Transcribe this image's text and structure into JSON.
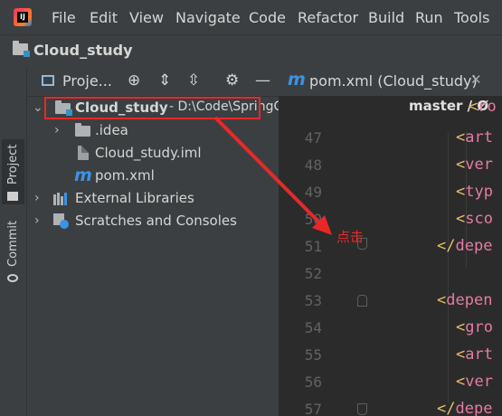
{
  "menu": {
    "items": [
      "File",
      "Edit",
      "View",
      "Navigate",
      "Code",
      "Refactor",
      "Build",
      "Run",
      "Tools"
    ],
    "logo_text": "IJ"
  },
  "navbar": {
    "project_name": "Cloud_study",
    "icon": "module-folder-icon"
  },
  "left_strip": {
    "project_tab": "Project",
    "commit_tab": "Commit"
  },
  "project_panel": {
    "title": "Proje...",
    "toolbar_icons": [
      "locate-icon",
      "expand-all-icon",
      "collapse-all-icon",
      "gear-icon",
      "minimize-icon"
    ],
    "tree": {
      "root": {
        "name": "Cloud_study",
        "path": "- D:\\Code\\SpringCloud\\Cloud_study",
        "vcs": "master / Ø"
      },
      "idea": ".idea",
      "iml": "Cloud_study.iml",
      "pom": "pom.xml",
      "external_libraries": "External Libraries",
      "scratches": "Scratches and Consoles"
    }
  },
  "editor": {
    "tab_label": "pom.xml (Cloud_study)",
    "tab_icon": "maven-icon",
    "line_numbers": [
      "47",
      "48",
      "49",
      "50",
      "51",
      "52",
      "53",
      "54",
      "55",
      "56",
      "57"
    ],
    "lines": [
      {
        "line": "47",
        "bracket": "<",
        "tag": "art"
      },
      {
        "line": "48",
        "bracket": "<",
        "tag": "ver"
      },
      {
        "line": "49",
        "bracket": "<",
        "tag": "typ"
      },
      {
        "line": "50",
        "bracket": "<",
        "tag": "sco"
      },
      {
        "line": "51",
        "bracket": "</",
        "tag": "depe"
      },
      {
        "line": "52",
        "bracket": "",
        "tag": ""
      },
      {
        "line": "53",
        "bracket": "<",
        "tag": "depen"
      },
      {
        "line": "54",
        "bracket": "<",
        "tag": "gro"
      },
      {
        "line": "55",
        "bracket": "<",
        "tag": "art"
      },
      {
        "line": "56",
        "bracket": "<",
        "tag": "ver"
      },
      {
        "line": "57",
        "bracket": "</",
        "tag": "depe"
      }
    ],
    "first_line_fragment": {
      "bracket": "<",
      "tag": "ro"
    }
  },
  "annotation": {
    "text": "点击",
    "color": "#e82828"
  },
  "colors": {
    "accent_red": "#e82828",
    "tag_pink": "#e57ba4",
    "bracket_yellow": "#e8bf6a",
    "blue": "#3b93e6"
  }
}
